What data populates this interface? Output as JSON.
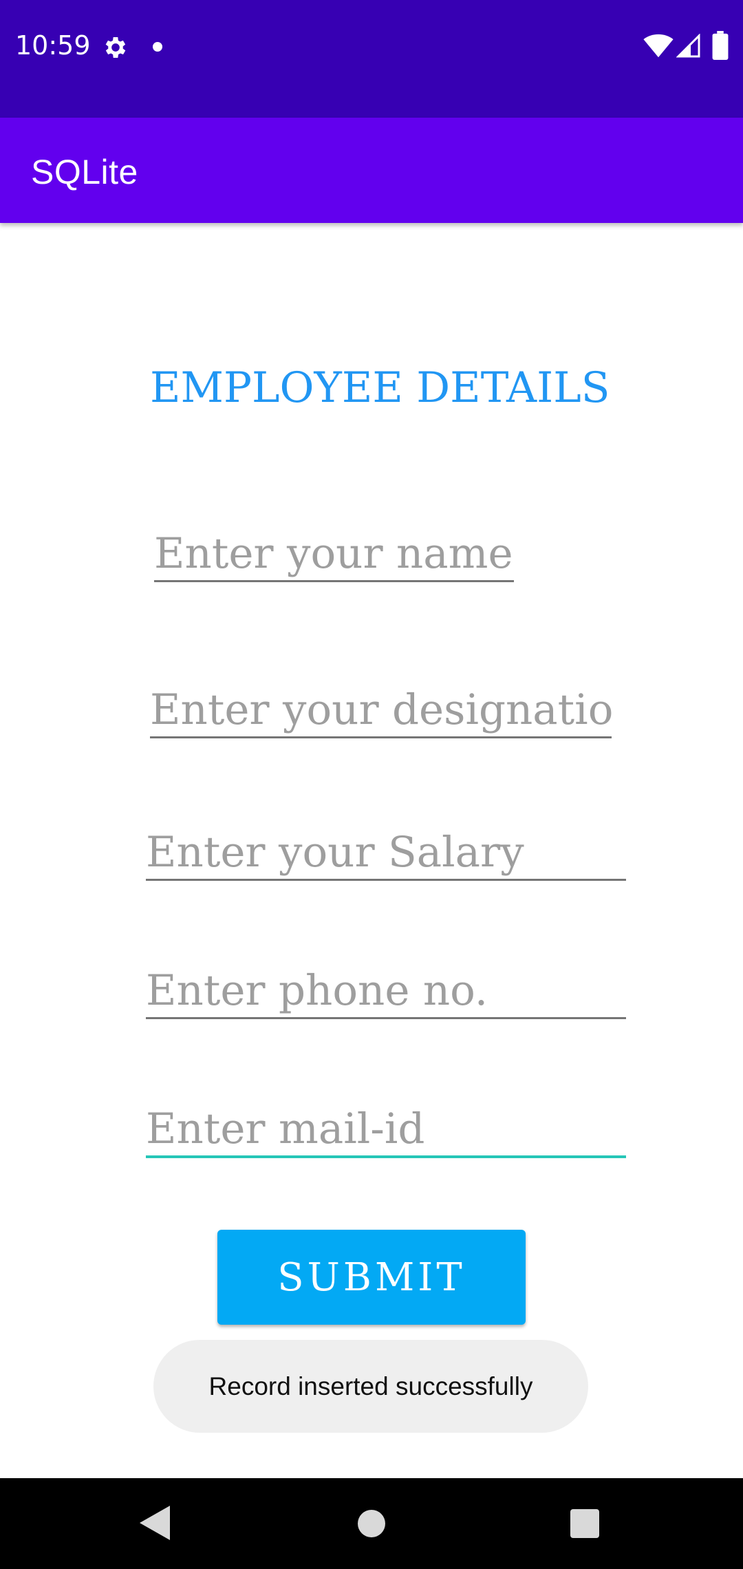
{
  "status_bar": {
    "time": "10:59",
    "icons": [
      "gear-icon",
      "notification-dot-icon",
      "wifi-icon",
      "cell-signal-icon",
      "battery-icon"
    ]
  },
  "app_bar": {
    "title": "SQLite",
    "color": "#6200ee"
  },
  "form": {
    "heading": "EMPLOYEE DETAILS",
    "name_placeholder": "Enter your name",
    "designation_placeholder": "Enter your designation",
    "salary_placeholder": "Enter your Salary",
    "phone_placeholder": "Enter phone no.",
    "mail_placeholder": "Enter mail-id",
    "submit_label": "SUBMIT"
  },
  "toast": {
    "message": "Record inserted successfully"
  },
  "colors": {
    "status_bar": "#3700b3",
    "heading": "#2196f3",
    "submit_button": "#03a9f4",
    "focus_underline": "#26c6b7"
  },
  "nav_bar": {
    "icons": [
      "back-icon",
      "home-icon",
      "recents-icon"
    ]
  }
}
